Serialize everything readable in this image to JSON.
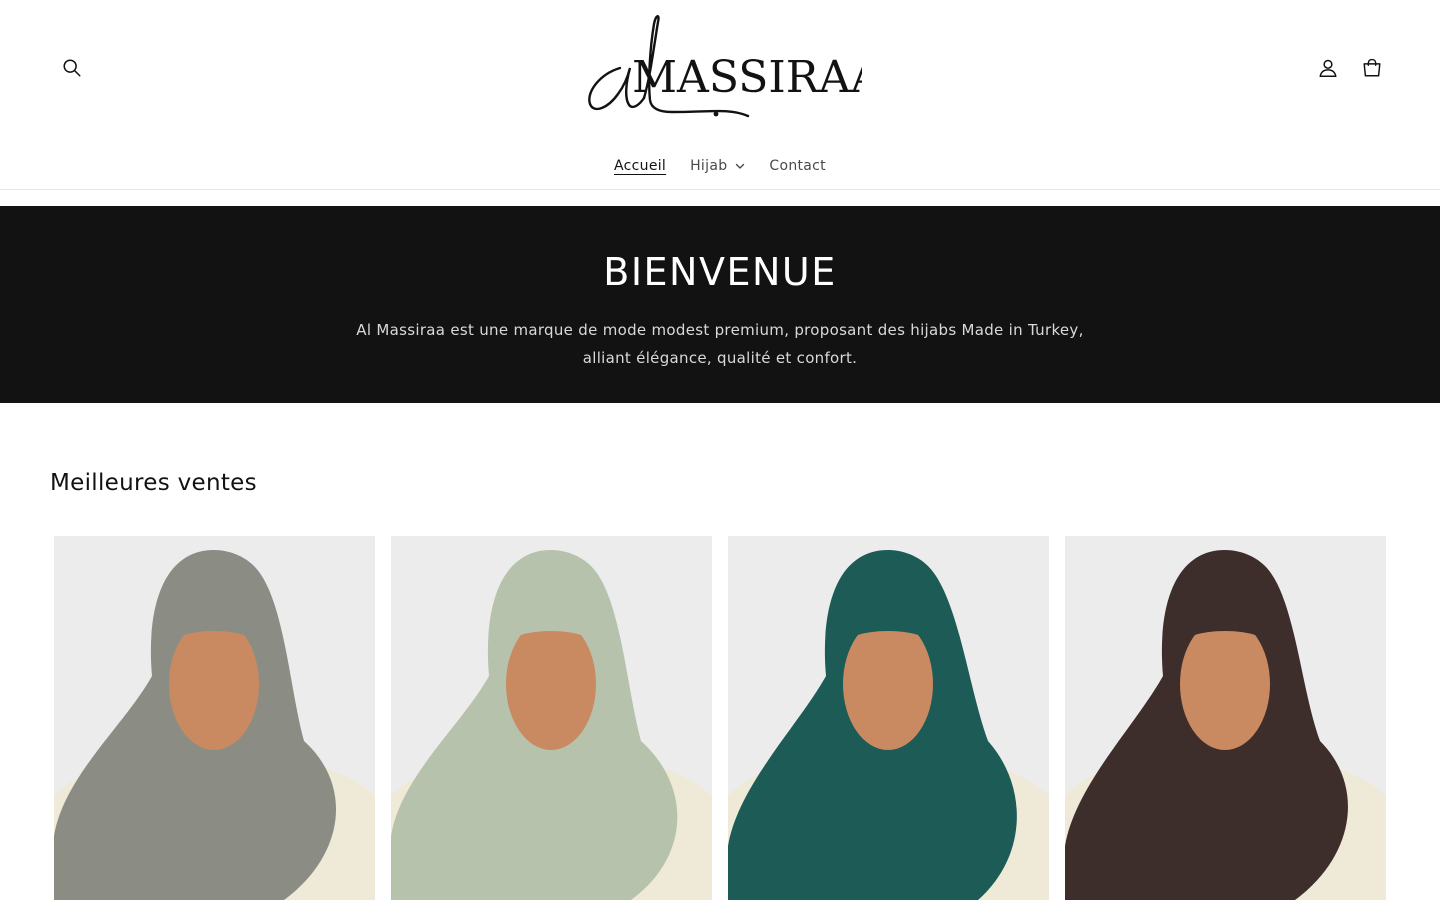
{
  "header": {
    "search_icon": "search-icon",
    "account_icon": "account-icon",
    "cart_icon": "cart-icon",
    "logo": {
      "prefix": "al",
      "name": "MASSIRAA"
    }
  },
  "nav": {
    "items": [
      {
        "label": "Accueil",
        "active": true
      },
      {
        "label": "Hijab",
        "has_dropdown": true
      },
      {
        "label": "Contact"
      }
    ]
  },
  "banner": {
    "title": "BIENVENUE",
    "text": "Al Massiraa est une marque de mode modest premium, proposant des hijabs Made in Turkey, alliant élégance, qualité et confort."
  },
  "bestsellers": {
    "title": "Meilleures ventes",
    "products": [
      {
        "hijab_color": "#8b8d84"
      },
      {
        "hijab_color": "#b7c2ad"
      },
      {
        "hijab_color": "#1c5b56"
      },
      {
        "hijab_color": "#3d2e2c"
      }
    ]
  },
  "colors": {
    "banner_bg": "#121212",
    "page_bg": "#ffffff",
    "card_bg": "#ececec"
  }
}
